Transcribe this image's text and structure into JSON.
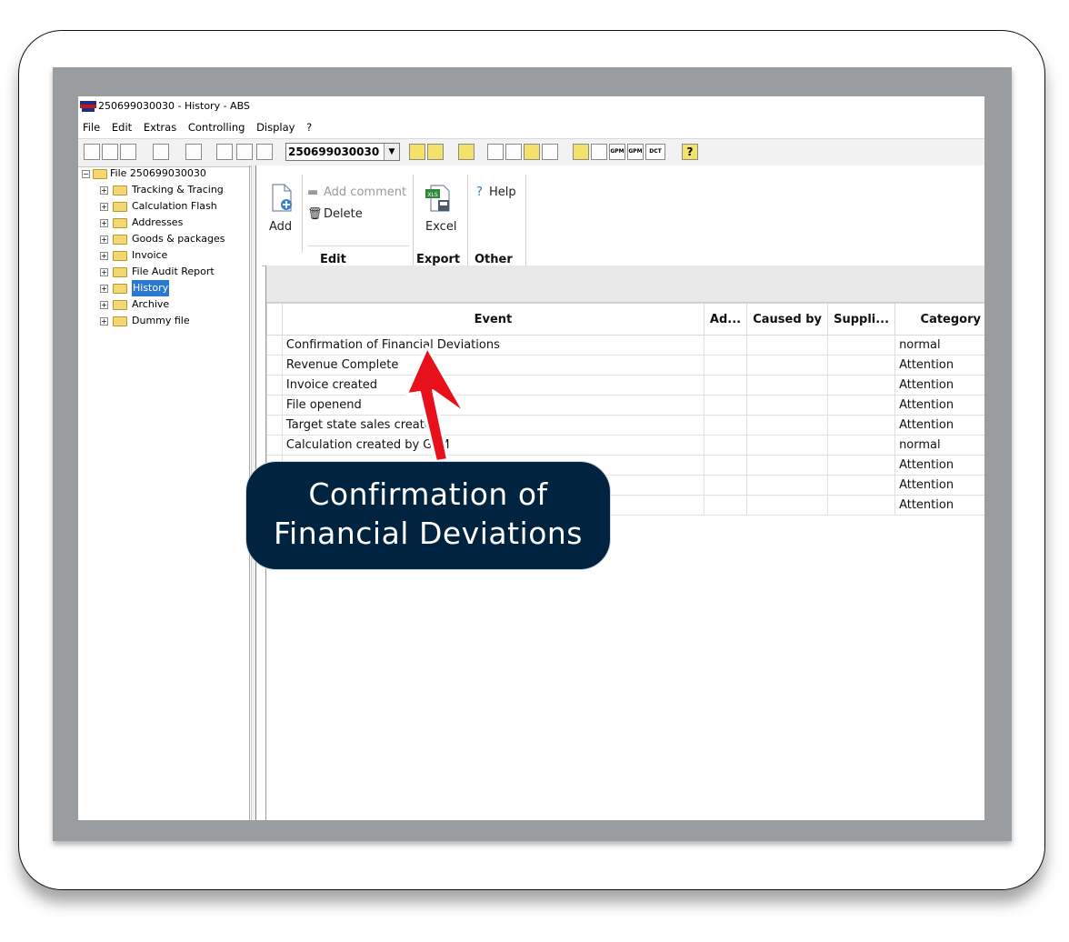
{
  "window": {
    "title": "250699030030 - History - ABS",
    "menu": [
      "File",
      "Edit",
      "Extras",
      "Controlling",
      "Display",
      "?"
    ]
  },
  "toolbar": {
    "file_number": "250699030030",
    "buttons": [
      "dct-icon",
      "help-icon"
    ],
    "dct_label": "DCT",
    "gpm_label": "GPM"
  },
  "tree": {
    "root": "File 250699030030",
    "items": [
      {
        "label": "Tracking & Tracing"
      },
      {
        "label": "Calculation Flash"
      },
      {
        "label": "Addresses"
      },
      {
        "label": "Goods & packages"
      },
      {
        "label": "Invoice"
      },
      {
        "label": "File Audit Report"
      },
      {
        "label": "History",
        "selected": true
      },
      {
        "label": "Archive"
      },
      {
        "label": "Dummy file"
      }
    ]
  },
  "ribbon": {
    "add": "Add",
    "add_comment": "Add comment",
    "delete": "Delete",
    "excel": "Excel",
    "xls_badge": "XLS",
    "help": "Help",
    "groups": {
      "edit": "Edit",
      "export": "Export",
      "other": "Other"
    }
  },
  "table": {
    "columns": [
      "Event",
      "Ad...",
      "Caused by",
      "Suppli...",
      "Category"
    ],
    "rows": [
      {
        "event": "Confirmation of Financial Deviations",
        "category": "normal"
      },
      {
        "event": "Revenue Complete",
        "category": "Attention"
      },
      {
        "event": "Invoice created",
        "category": "Attention"
      },
      {
        "event": "File openend",
        "category": "Attention"
      },
      {
        "event": "Target state sales created",
        "category": "Attention"
      },
      {
        "event": "Calculation created by GPM",
        "category": "normal"
      },
      {
        "event": "",
        "category": "Attention"
      },
      {
        "event": "",
        "category": "Attention"
      },
      {
        "event": "",
        "category": "Attention"
      }
    ]
  },
  "callout": {
    "line1": "Confirmation of",
    "line2": "Financial Deviations",
    "background": "#002340"
  },
  "colors": {
    "frame": "#9a9d9f",
    "selection": "#2a78d0",
    "arrow": "#e8101a"
  }
}
